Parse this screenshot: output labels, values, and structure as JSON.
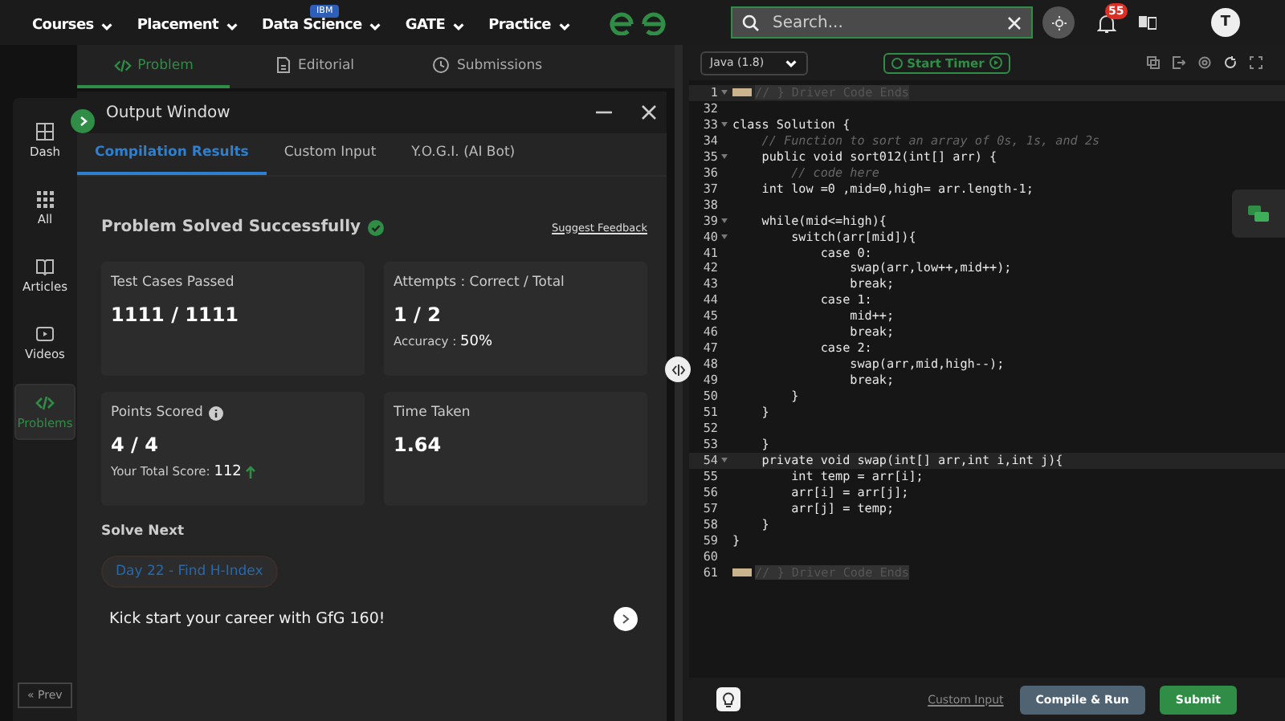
{
  "nav": {
    "items": [
      {
        "label": "Courses"
      },
      {
        "label": "Placement"
      },
      {
        "label": "Data Science",
        "badge": "IBM"
      },
      {
        "label": "GATE"
      },
      {
        "label": "Practice"
      }
    ],
    "search": {
      "placeholder": "Search..."
    },
    "notifications": "55",
    "avatar": "T"
  },
  "problem_tabs": [
    {
      "label": "Problem",
      "selected": true,
      "kind": "code"
    },
    {
      "label": "Editorial",
      "selected": false,
      "kind": "doc"
    },
    {
      "label": "Submissions",
      "selected": false,
      "kind": "clock"
    }
  ],
  "left_rail": {
    "items": [
      {
        "label": "Dash",
        "kind": "dash",
        "selected": false
      },
      {
        "label": "All",
        "kind": "grid",
        "selected": false
      },
      {
        "label": "Articles",
        "kind": "book",
        "selected": false
      },
      {
        "label": "Videos",
        "kind": "video",
        "selected": false
      },
      {
        "label": "Problems",
        "kind": "code",
        "selected": true
      }
    ],
    "prev_button": "« Prev"
  },
  "output_window": {
    "title": "Output Window",
    "tabs": [
      {
        "label": "Compilation Results",
        "selected": true
      },
      {
        "label": "Custom Input",
        "selected": false
      },
      {
        "label": "Y.O.G.I. (AI Bot)",
        "selected": false
      }
    ],
    "status": "Problem Solved Successfully",
    "feedback_link": "Suggest Feedback",
    "cards": [
      {
        "title": "Test Cases Passed",
        "info": false,
        "value": "1111 / 1111"
      },
      {
        "title": "Attempts : Correct / Total",
        "info": false,
        "value": "1 / 2",
        "note": {
          "label": "Accuracy : ",
          "value": "50%",
          "trend": false
        }
      },
      {
        "title": "Points Scored",
        "info": true,
        "value": "4 / 4",
        "note": {
          "label": "Your Total Score: ",
          "value": "112",
          "trend": true
        }
      },
      {
        "title": "Time Taken",
        "info": false,
        "value": "1.64"
      }
    ],
    "solve_next": {
      "heading": "Solve Next",
      "chip": "Day 22 - Find H-Index",
      "banner": "Kick start your career with GfG 160!"
    }
  },
  "editor": {
    "language": "Java (1.8)",
    "timer_button": "Start Timer",
    "lines": [
      {
        "num": "1",
        "text": "// } Driver Code Ends",
        "kind": "marker",
        "foldable": true,
        "highlighted": true
      },
      {
        "num": "32",
        "kind": "blank",
        "foldable": false,
        "highlighted": false
      },
      {
        "num": "33",
        "text": "class Solution {",
        "kind": "code",
        "foldable": true,
        "highlighted": false
      },
      {
        "num": "34",
        "text": "    // Function to sort an array of 0s, 1s, and 2s",
        "kind": "comment",
        "foldable": false,
        "highlighted": false
      },
      {
        "num": "35",
        "text": "    public void sort012(int[] arr) {",
        "kind": "code",
        "foldable": true,
        "highlighted": false
      },
      {
        "num": "36",
        "text": "        // code here",
        "kind": "comment",
        "foldable": false,
        "highlighted": false
      },
      {
        "num": "37",
        "text": "    int low =0 ,mid=0,high= arr.length-1;",
        "kind": "code",
        "foldable": false,
        "highlighted": false
      },
      {
        "num": "38",
        "kind": "blank",
        "foldable": false,
        "highlighted": false
      },
      {
        "num": "39",
        "text": "    while(mid<=high){",
        "kind": "code",
        "foldable": true,
        "highlighted": false
      },
      {
        "num": "40",
        "text": "        switch(arr[mid]){",
        "kind": "code",
        "foldable": true,
        "highlighted": false
      },
      {
        "num": "41",
        "text": "            case 0:",
        "kind": "code",
        "foldable": false,
        "highlighted": false
      },
      {
        "num": "42",
        "text": "                swap(arr,low++,mid++);",
        "kind": "code",
        "foldable": false,
        "highlighted": false
      },
      {
        "num": "43",
        "text": "                break;",
        "kind": "code",
        "foldable": false,
        "highlighted": false
      },
      {
        "num": "44",
        "text": "            case 1:",
        "kind": "code",
        "foldable": false,
        "highlighted": false
      },
      {
        "num": "45",
        "text": "                mid++;",
        "kind": "code",
        "foldable": false,
        "highlighted": false
      },
      {
        "num": "46",
        "text": "                break;",
        "kind": "code",
        "foldable": false,
        "highlighted": false
      },
      {
        "num": "47",
        "text": "            case 2:",
        "kind": "code",
        "foldable": false,
        "highlighted": false
      },
      {
        "num": "48",
        "text": "                swap(arr,mid,high--);",
        "kind": "code",
        "foldable": false,
        "highlighted": false
      },
      {
        "num": "49",
        "text": "                break;",
        "kind": "code",
        "foldable": false,
        "highlighted": false
      },
      {
        "num": "50",
        "text": "        }",
        "kind": "code",
        "foldable": false,
        "highlighted": false
      },
      {
        "num": "51",
        "text": "    }",
        "kind": "code",
        "foldable": false,
        "highlighted": false
      },
      {
        "num": "52",
        "kind": "blank",
        "foldable": false,
        "highlighted": false
      },
      {
        "num": "53",
        "text": "    }",
        "kind": "code",
        "foldable": false,
        "highlighted": false
      },
      {
        "num": "54",
        "text": "    private void swap(int[] arr,int i,int j){",
        "kind": "code",
        "foldable": true,
        "highlighted": true
      },
      {
        "num": "55",
        "text": "        int temp = arr[i];",
        "kind": "code",
        "foldable": false,
        "highlighted": false
      },
      {
        "num": "56",
        "text": "        arr[i] = arr[j];",
        "kind": "code",
        "foldable": false,
        "highlighted": false
      },
      {
        "num": "57",
        "text": "        arr[j] = temp;",
        "kind": "code",
        "foldable": false,
        "highlighted": false
      },
      {
        "num": "58",
        "text": "    }",
        "kind": "code",
        "foldable": false,
        "highlighted": false
      },
      {
        "num": "59",
        "text": "}",
        "kind": "code",
        "foldable": false,
        "highlighted": false
      },
      {
        "num": "60",
        "kind": "blank",
        "foldable": false,
        "highlighted": false
      },
      {
        "num": "61",
        "text": "// } Driver Code Ends",
        "kind": "marker",
        "foldable": false,
        "highlighted": false
      }
    ],
    "custom_input_link": "Custom Input",
    "compile_button": "Compile & Run",
    "submit_button": "Submit"
  }
}
